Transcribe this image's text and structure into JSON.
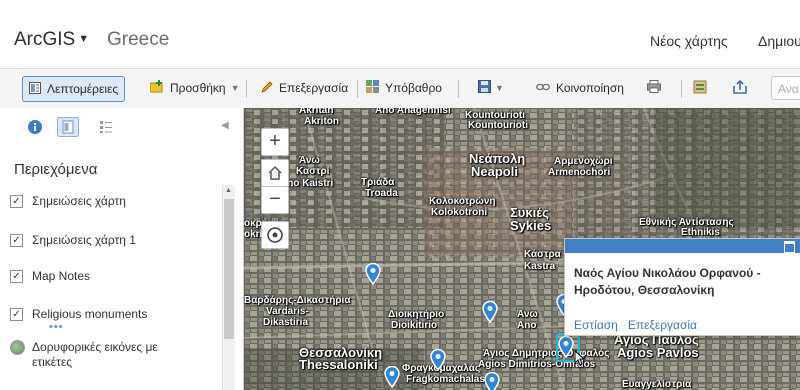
{
  "header": {
    "brand": "ArcGIS",
    "map_title": "Greece",
    "new_map": "Νέος χάρτης",
    "create_presentation": "Δημιου"
  },
  "toolbar": {
    "details": "Λεπτομέρειες",
    "add": "Προσθήκη",
    "edit": "Επεξεργασία",
    "basemap": "Υπόβαθρο",
    "share": "Κοινοποίηση",
    "search_placeholder": "Ανα"
  },
  "panel": {
    "contents_title": "Περιεχόμενα",
    "layers": [
      {
        "label": "Σημειώσεις χάρτη",
        "checked": true
      },
      {
        "label": "Σημειώσεις χάρτη 1",
        "checked": true
      },
      {
        "label": "Map Notes",
        "checked": true
      },
      {
        "label": "Religious monuments",
        "checked": true
      },
      {
        "label": "Δορυφορικές εικόνες με ετικέτες",
        "checked": false
      }
    ],
    "more": "•••"
  },
  "map": {
    "labels": [
      "Akritan",
      "Akriton",
      "Ano Anagennisi",
      "Kountouriotı",
      "Kountourioti",
      "Άνω",
      "Καστρί",
      "Ano Kaistri",
      "Τριάδα",
      "Troada",
      "Νεάπολη",
      "Neapoli",
      "Αρμενοχώρι",
      "Armenochori",
      "Κολοκοτρώνη",
      "Kolokotroni",
      "Συκιές",
      "Sykies",
      "Εθνικής Αντίστασης",
      "Ethnikis",
      "οκρήνη",
      "okrini",
      "Κάστρα",
      "Kastra",
      "Βαρδάρης-Δικαστήρια",
      "Vardaris-",
      "Dikastiria",
      "Διοικητήριο",
      "Dioikitirio",
      "Άνω",
      "Ano",
      "Θεσσαλονίκη",
      "Thessaloniki",
      "Φραγκομαχαλάς",
      "Fragkomachalas",
      "Άγιος Δημήτριος-Ομφαλός",
      "Agios Dimitrios-Omfalos",
      "Άγιος Παύλος",
      "Agios Pavlos",
      "Ευαγγελίστρια"
    ]
  },
  "popup": {
    "title": "Ναός Αγίου Νικολάου Ορφανού - Ηροδότου, Θεσσαλονίκη",
    "zoom_to": "Εστίαση",
    "edit": "Επεξεργασία"
  },
  "colors": {
    "accent": "#3f7fc4",
    "pin": "#2f86d6",
    "selected_toggle_bg": "#dde9f7"
  }
}
